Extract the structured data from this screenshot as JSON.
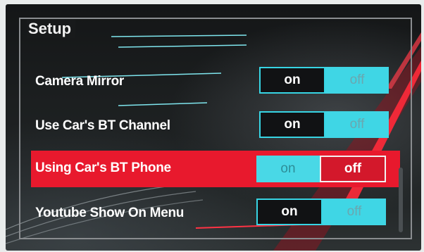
{
  "page": {
    "title": "Setup"
  },
  "settings": [
    {
      "label": "Camera Mirror",
      "on_label": "on",
      "off_label": "off",
      "value": "on",
      "highlighted": false
    },
    {
      "label": "Use Car's BT Channel",
      "on_label": "on",
      "off_label": "off",
      "value": "on",
      "highlighted": false
    },
    {
      "label": "Using Car's BT Phone",
      "on_label": "on",
      "off_label": "off",
      "value": "off",
      "highlighted": true
    },
    {
      "label": "Youtube Show On Menu",
      "on_label": "on",
      "off_label": "off",
      "value": "on",
      "highlighted": false
    }
  ],
  "colors": {
    "highlight": "#e8192d",
    "accent_cyan": "#3fd6e5",
    "frame": "#8a8d90"
  }
}
